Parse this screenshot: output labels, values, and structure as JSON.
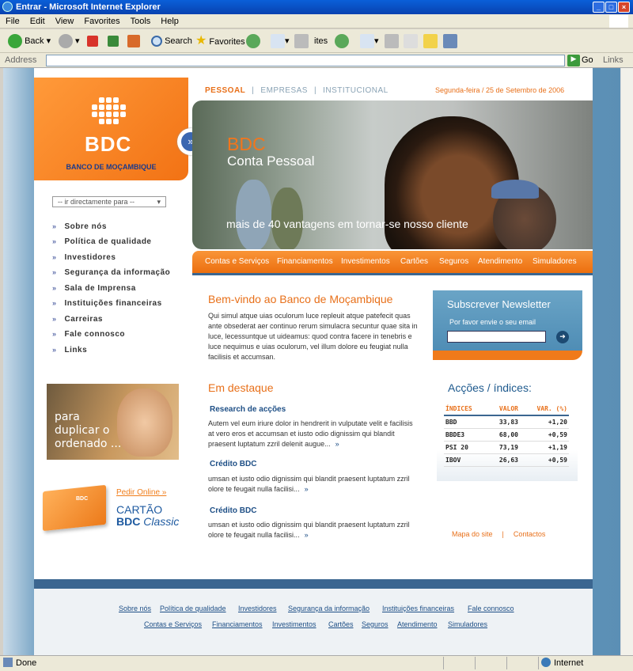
{
  "window": {
    "title": "Entrar - Microsoft Internet Explorer"
  },
  "menu": [
    "File",
    "Edit",
    "View",
    "Favorites",
    "Tools",
    "Help"
  ],
  "toolbar": {
    "back": "Back",
    "search": "Search",
    "favorites": "Favorites",
    "ites": "ites"
  },
  "address": {
    "label": "Address",
    "value": "",
    "go": "Go",
    "links": "Links"
  },
  "status": {
    "text": "Done",
    "zone": "Internet"
  },
  "brand": {
    "logo": "BDC",
    "name": "BANCO DE MOÇAMBIQUE",
    "accent": "#f27214",
    "blue": "#3b6690"
  },
  "top_tabs": [
    "PESSOAL",
    "EMPRESAS",
    "INSTITUCIONAL"
  ],
  "date": "Segunda-feira / 25 de Setembro de 2006",
  "quick_select": "-- ir directamente para --",
  "sidebar": {
    "items": [
      "Sobre nós",
      "Política de qualidade",
      "Investidores",
      "Segurança da informação",
      "Sala de Imprensa",
      "Instituições financeiras",
      "Carreiras",
      "Fale connosco",
      "Links"
    ]
  },
  "hero": {
    "brand": "BDC",
    "product": "Conta Pessoal",
    "tagline": "mais de 40 vantagens em tornar-se nosso cliente"
  },
  "main_nav": [
    "Contas e Serviços",
    "Financiamentos",
    "Investimentos",
    "Cartões",
    "Seguros",
    "Atendimento",
    "Simuladores"
  ],
  "welcome": {
    "title": "Bem-vindo ao Banco de Moçambique",
    "text": "Qui simul atque uias oculorum luce repleuit atque patefecit quas ante obsederat aer continuo rerum simulacra secuntur quae sita in luce, lecessuntque ut uideamus: quod contra facere in tenebris e luce nequimus e uias oculorum, vel illum dolore eu feugiat nulla facilisis et accumsan."
  },
  "newsletter": {
    "title": "Subscrever Newsletter",
    "sub": "Por favor envie o seu email"
  },
  "promo": {
    "text": "para duplicar o ordenado ...",
    "pedir": "Pedir Online »",
    "cartao1": "CARTÃO",
    "cartao2": "BDC",
    "cartao3": "Classic",
    "card_logo": "BDC"
  },
  "destaque": {
    "title": "Em destaque",
    "articles": [
      {
        "title": "Research de acções",
        "text": "Autem vel eum iriure dolor in hendrerit in vulputate velit e facilisis at vero eros et accumsan et iusto odio dignissim qui blandit praesent luptatum zzril delenit augue...",
        "more": "»"
      },
      {
        "title": "Crédito BDC",
        "text": "umsan et iusto odio dignissim qui blandit praesent luptatum zzril olore te feugait nulla facilisi...",
        "more": "»"
      },
      {
        "title": "Crédito BDC",
        "text": "umsan et iusto odio dignissim qui blandit praesent luptatum zzril olore te feugait nulla facilisi...",
        "more": "»"
      }
    ]
  },
  "acoes": {
    "title": "Acções / índices:",
    "headers": [
      "ÍNDICES",
      "VALOR",
      "VAR. (%)"
    ],
    "rows": [
      [
        "BBD",
        "33,83",
        "+1,20"
      ],
      [
        "BBDE3",
        "68,00",
        "+0,59"
      ],
      [
        "PSI 20",
        "73,19",
        "+1,19"
      ],
      [
        "IBOV",
        "26,63",
        "+0,59"
      ]
    ]
  },
  "aux_links": {
    "mapa": "Mapa do site",
    "sep": "|",
    "contactos": "Contactos"
  },
  "footer": {
    "row1": [
      "Sobre nós",
      "Política de qualidade",
      "Investidores",
      "Segurança da informação",
      "Instituições financeiras",
      "Fale connosco"
    ],
    "row2": [
      "Contas e Serviços",
      "Financiamentos",
      "Investimentos",
      "Cartões",
      "Seguros",
      "Atendimento",
      "Simuladores"
    ]
  }
}
